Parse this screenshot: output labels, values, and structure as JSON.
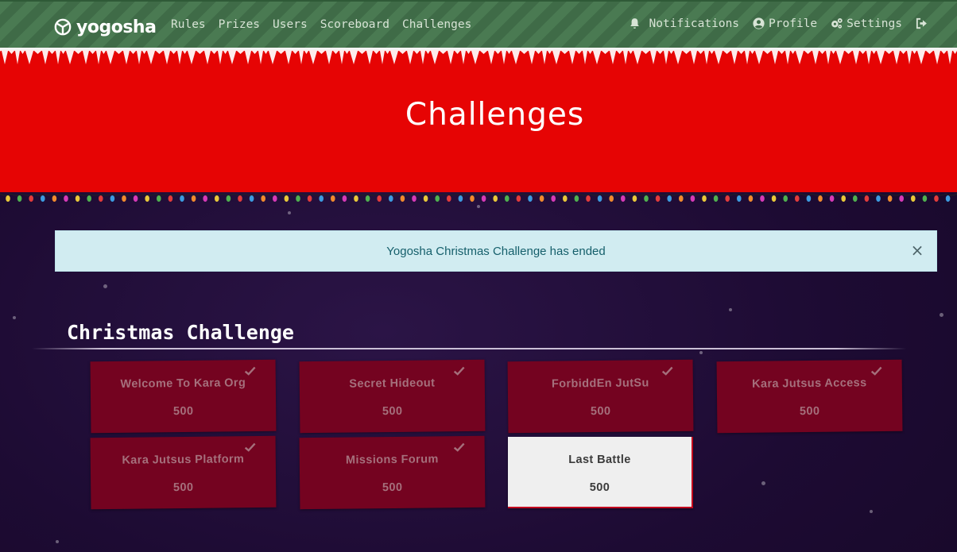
{
  "brand": {
    "name": "yogosha",
    "logo_icon": "yogosha-logo-icon"
  },
  "nav": {
    "left": [
      {
        "label": "Rules"
      },
      {
        "label": "Prizes"
      },
      {
        "label": "Users"
      },
      {
        "label": "Scoreboard"
      },
      {
        "label": "Challenges"
      }
    ],
    "right": [
      {
        "label": "Notifications",
        "icon": "bell-icon"
      },
      {
        "label": "Profile",
        "icon": "user-circle-icon"
      },
      {
        "label": "Settings",
        "icon": "gears-icon"
      },
      {
        "label": "",
        "icon": "logout-icon"
      }
    ]
  },
  "hero": {
    "title": "Challenges"
  },
  "alert": {
    "message": "Yogosha Christmas Challenge has ended",
    "close_glyph": "×"
  },
  "category": {
    "title": "Christmas Challenge"
  },
  "challenges": [
    {
      "name": "Welcome To Kara Org",
      "points": "500",
      "solved": true
    },
    {
      "name": "Secret Hideout",
      "points": "500",
      "solved": true
    },
    {
      "name": "ForbiddEn JutSu",
      "points": "500",
      "solved": true
    },
    {
      "name": "Kara Jutsus Access",
      "points": "500",
      "solved": true
    },
    {
      "name": "Kara Jutsus Platform",
      "points": "500",
      "solved": true
    },
    {
      "name": "Missions Forum",
      "points": "500",
      "solved": true
    },
    {
      "name": "Last Battle",
      "points": "500",
      "solved": false
    }
  ],
  "colors": {
    "navbar": "#4a7a52",
    "hero": "#e60404",
    "solved_card": "#740320",
    "open_card": "#efefef",
    "alert_bg": "#d1ecf1",
    "background": "#1d0b33"
  }
}
